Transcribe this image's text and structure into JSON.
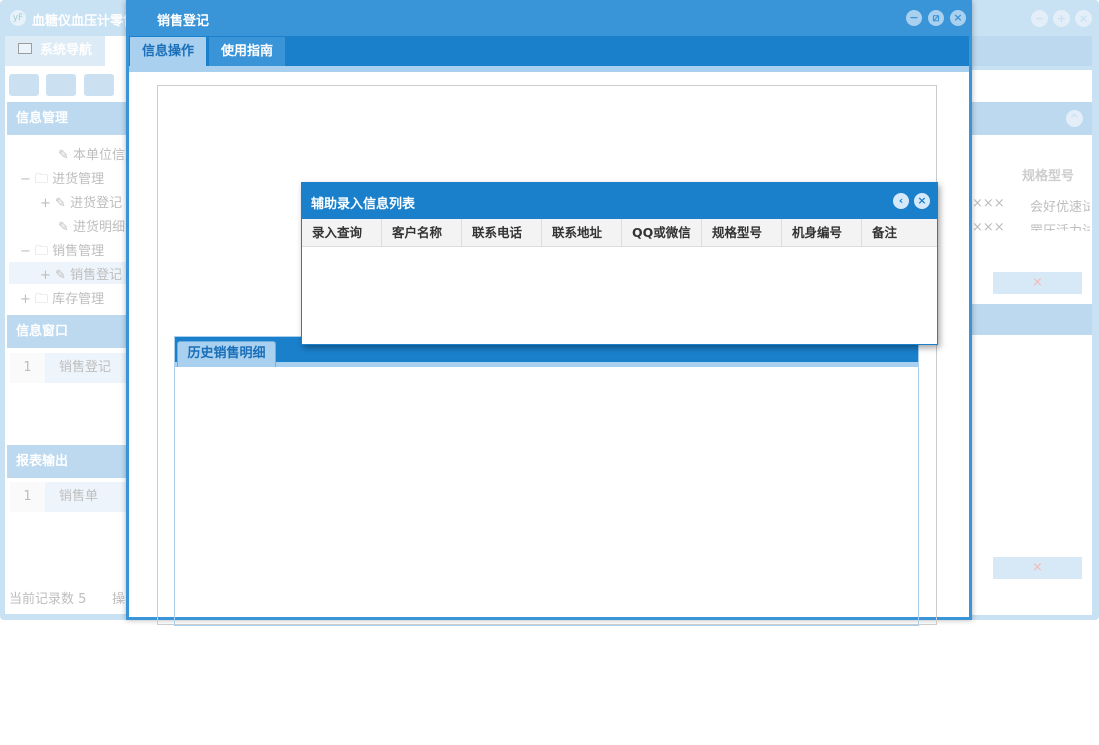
{
  "app": {
    "title": "血糖仪血压计零售",
    "nav_tab": "系统导航",
    "sections": {
      "info_mgmt": "信息管理",
      "info_window": "信息窗口",
      "report": "报表输出"
    },
    "tree": [
      "本单位信息",
      "进货管理",
      "进货登记",
      "进货明细",
      "销售管理",
      "销售登记",
      "库存管理"
    ],
    "info_window_rows": [
      {
        "n": "1",
        "label": "销售登记"
      }
    ],
    "report_rows": [
      {
        "n": "1",
        "label": "销售单"
      }
    ],
    "status": "当前记录数 5",
    "status2": "操",
    "right_table": {
      "header": "规格型号",
      "rows": [
        {
          "a": "×××",
          "b": "会好优速试"
        },
        {
          "a": "×××",
          "b": "罡压活力试"
        }
      ]
    },
    "x_btn": "×"
  },
  "dialog": {
    "title": "销售登记",
    "tabs": [
      "信息操作",
      "使用指南"
    ],
    "history_tab": "历史销售明细"
  },
  "popup": {
    "title": "辅助录入信息列表",
    "columns": [
      "录入查询",
      "客户名称",
      "联系电话",
      "联系地址",
      "QQ或微信",
      "规格型号",
      "机身编号",
      "备注"
    ]
  },
  "colors": {
    "primary": "#1a80cc",
    "title": "#3a94d8",
    "faded": "#c6e0f3"
  }
}
